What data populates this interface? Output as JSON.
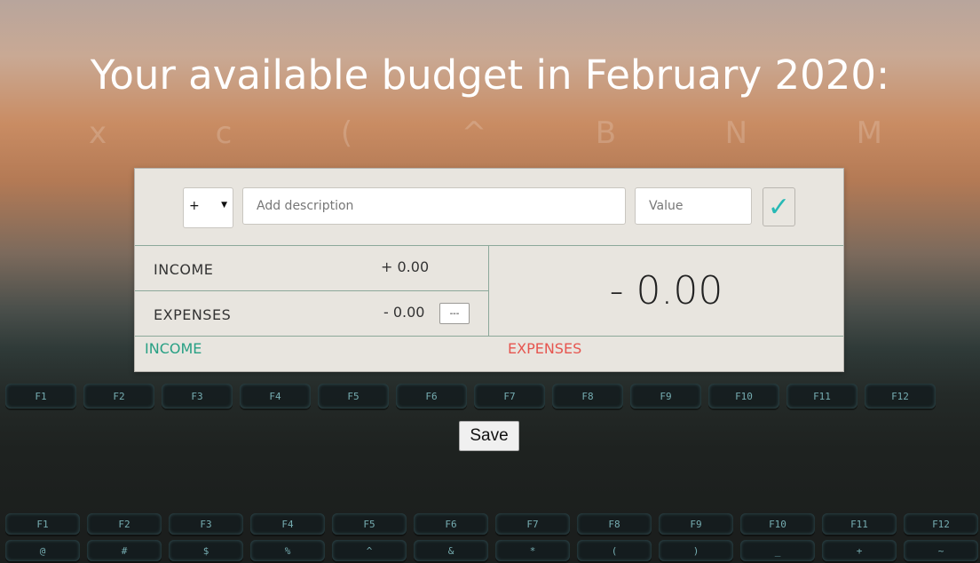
{
  "header": {
    "title": "Your available budget in February 2020:"
  },
  "add_form": {
    "type_select": {
      "selected": "+"
    },
    "description_placeholder": "Add description",
    "value_placeholder": "Value",
    "submit_icon": "checkmark-icon",
    "submit_glyph": "✓"
  },
  "summary": {
    "income_label": "INCOME",
    "income_value": "+ 0.00",
    "expenses_label": "EXPENSES",
    "expenses_value": "- 0.00",
    "expenses_percentage": "---",
    "budget_total": "- 0.00"
  },
  "lists": {
    "income_title": "INCOME",
    "expenses_title": "EXPENSES"
  },
  "save_label": "Save",
  "colors": {
    "income": "#28a084",
    "expenses": "#e6554f",
    "accent": "#28b9b5"
  }
}
